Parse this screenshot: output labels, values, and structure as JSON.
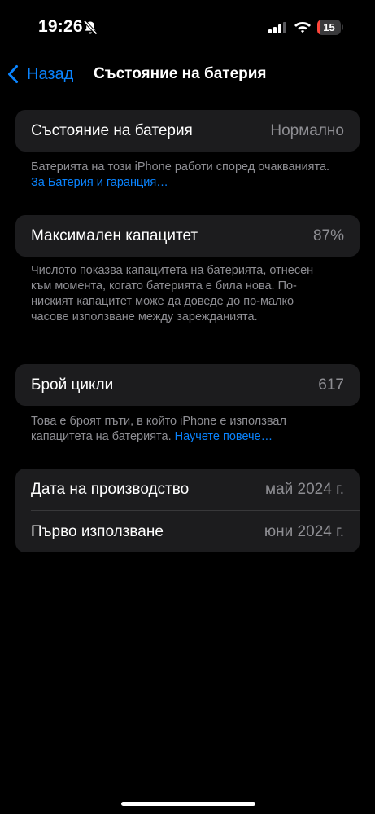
{
  "status_bar": {
    "time": "19:26",
    "battery_level": "15"
  },
  "nav": {
    "back_label": "Назад",
    "title": "Състояние на батерия"
  },
  "health": {
    "label": "Състояние на батерия",
    "value": "Нормално",
    "footer_text": "Батерията на този iPhone работи според очакванията. ",
    "footer_link": "За Батерия и гаранция…"
  },
  "capacity": {
    "label": "Максимален капацитет",
    "value": "87%",
    "footer_text": "Числото показва капацитета на батерията, отнесен към момента, когато батерията е била нова. По-ниският капацитет може да доведе до по-малко часове използване между зарежданията."
  },
  "cycles": {
    "label": "Брой цикли",
    "value": "617",
    "footer_text": "Това е броят пъти, в който iPhone е използвал капацитета на батерията. ",
    "footer_link": "Научете повече…"
  },
  "dates": {
    "manufacture_label": "Дата на производство",
    "manufacture_value": "май 2024 г.",
    "first_use_label": "Първо използване",
    "first_use_value": "юни 2024 г."
  },
  "colors": {
    "accent": "#0a84ff",
    "card": "#1c1c1e",
    "secondary_text": "#8e8e93",
    "battery_low": "#ff453a"
  }
}
